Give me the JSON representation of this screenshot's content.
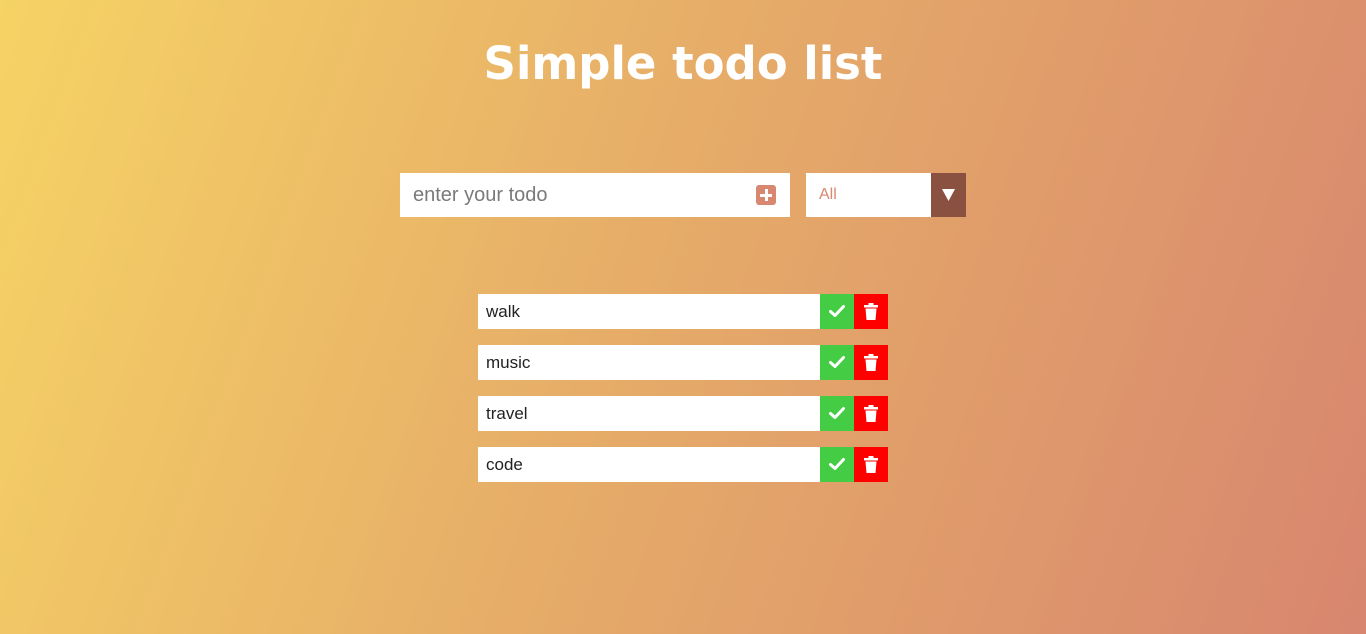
{
  "header": {
    "title": "Simple todo list"
  },
  "form": {
    "placeholder": "enter your todo",
    "add_icon": "plus-square-icon",
    "filter_selected": "All",
    "filter_icon": "caret-down-icon"
  },
  "todos": [
    {
      "text": "walk"
    },
    {
      "text": "music"
    },
    {
      "text": "travel"
    },
    {
      "text": "code"
    }
  ],
  "item_icons": {
    "complete": "check-icon",
    "delete": "trash-icon"
  },
  "colors": {
    "accent": "#d88771",
    "filter_button": "#8b5140",
    "complete": "#44cc44",
    "delete": "#ff0000",
    "title": "#ffffff"
  }
}
